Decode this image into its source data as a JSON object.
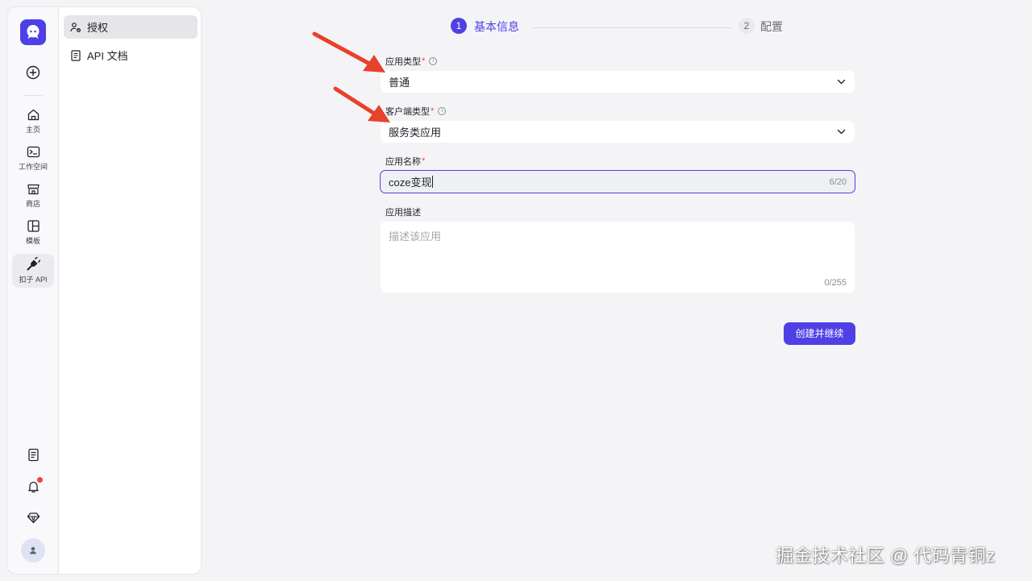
{
  "rail": {
    "create_icon": "plus-circle-icon",
    "items": [
      {
        "label": "主页",
        "icon": "home-icon"
      },
      {
        "label": "工作空间",
        "icon": "terminal-folder-icon"
      },
      {
        "label": "商店",
        "icon": "store-icon"
      },
      {
        "label": "模板",
        "icon": "template-icon"
      },
      {
        "label": "扣子 API",
        "icon": "plug-icon",
        "active": true
      }
    ],
    "bottom_icons": [
      "document-icon",
      "bell-icon",
      "diamond-icon",
      "avatar"
    ]
  },
  "subnav": {
    "items": [
      {
        "label": "授权",
        "icon": "key-user-icon",
        "active": true
      },
      {
        "label": "API 文档",
        "icon": "document-icon",
        "active": false
      }
    ]
  },
  "stepper": {
    "steps": [
      {
        "number": "1",
        "label": "基本信息",
        "active": true
      },
      {
        "number": "2",
        "label": "配置",
        "active": false
      }
    ]
  },
  "form": {
    "app_type": {
      "label": "应用类型",
      "required_mark": "*",
      "value": "普通"
    },
    "client_type": {
      "label": "客户端类型",
      "required_mark": "*",
      "value": "服务类应用"
    },
    "app_name": {
      "label": "应用名称",
      "required_mark": "*",
      "value": "coze变现",
      "counter": "6/20"
    },
    "app_desc": {
      "label": "应用描述",
      "placeholder": "描述该应用",
      "counter": "0/255"
    },
    "submit_label": "创建并继续"
  },
  "watermark": "掘金技术社区 @ 代码青铜z",
  "colors": {
    "accent": "#4e40e5",
    "annotation_arrow": "#e8412c",
    "required": "#f0433d",
    "background": "#f4f4f7"
  }
}
